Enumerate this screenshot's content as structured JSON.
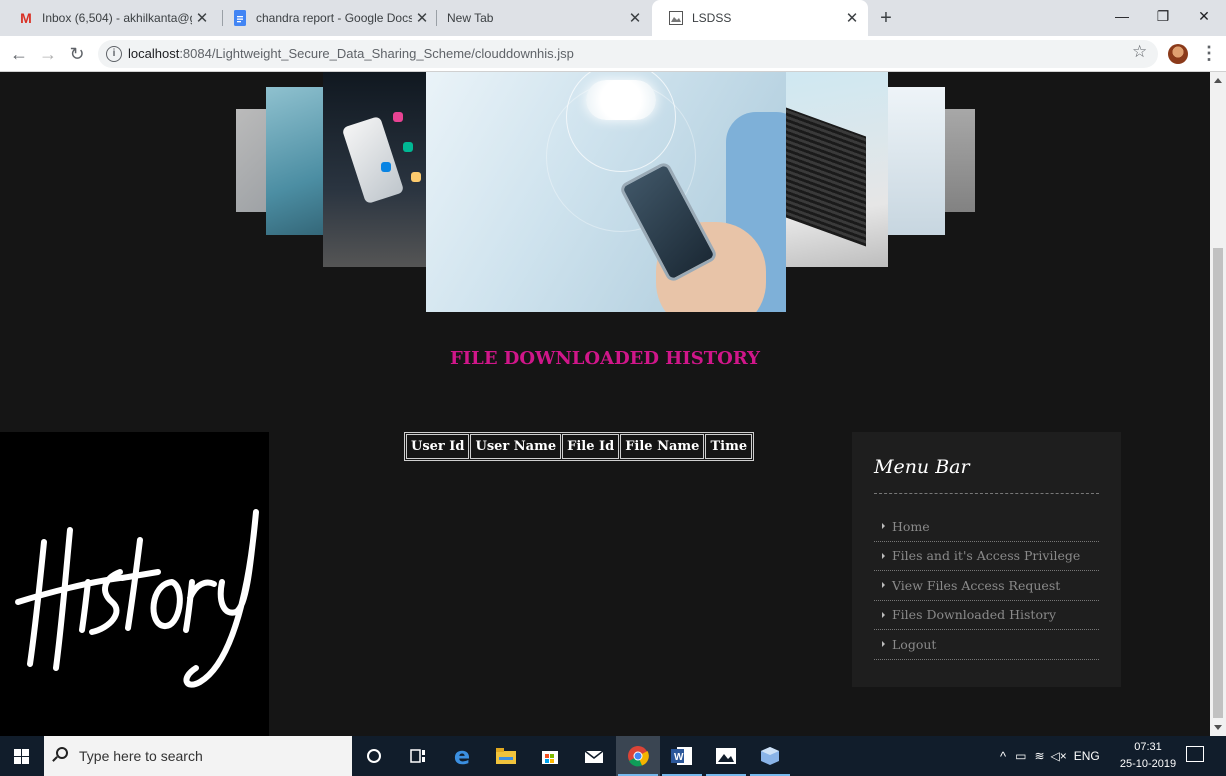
{
  "browser": {
    "tabs": [
      {
        "title": "Inbox (6,504) - akhilkanta@gmai",
        "icon": "gmail-icon",
        "active": false
      },
      {
        "title": "chandra report - Google Docs",
        "icon": "docs-icon",
        "active": false
      },
      {
        "title": "New Tab",
        "icon": "",
        "active": false
      },
      {
        "title": "LSDSS",
        "icon": "site-icon",
        "active": true
      }
    ],
    "url_host": "localhost",
    "url_rest": ":8084/Lightweight_Secure_Data_Sharing_Scheme/clouddownhis.jsp"
  },
  "page": {
    "title": "FILE DOWNLOADED HISTORY",
    "history_image_text": "History",
    "table": {
      "headers": [
        "User Id",
        "User Name",
        "File Id",
        "File Name",
        "Time"
      ]
    },
    "menu": {
      "title": "Menu Bar",
      "items": [
        "Home",
        "Files and it's Access Privilege",
        "View Files Access Request",
        "Files Downloaded History",
        "Logout"
      ]
    }
  },
  "taskbar": {
    "search_placeholder": "Type here to search",
    "language": "ENG",
    "time": "07:31",
    "date": "25-10-2019"
  },
  "colors": {
    "title": "#d0168a",
    "background": "#151515",
    "menu_bg": "#1e1e1e"
  }
}
